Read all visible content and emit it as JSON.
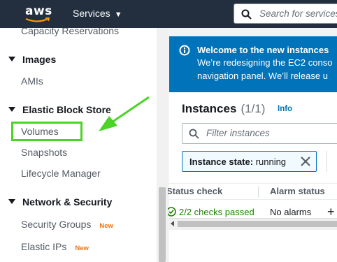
{
  "topbar": {
    "logo_text": "aws",
    "services_label": "Services",
    "search_placeholder": "Search for services"
  },
  "sidebar": {
    "items": [
      {
        "type": "link",
        "label": "Capacity Reservations"
      },
      {
        "type": "section",
        "label": "Images"
      },
      {
        "type": "link",
        "label": "AMIs"
      },
      {
        "type": "section",
        "label": "Elastic Block Store"
      },
      {
        "type": "link",
        "label": "Volumes",
        "highlighted": true
      },
      {
        "type": "link",
        "label": "Snapshots"
      },
      {
        "type": "link",
        "label": "Lifecycle Manager"
      },
      {
        "type": "section",
        "label": "Network & Security"
      },
      {
        "type": "link",
        "label": "Security Groups",
        "badge": "New"
      },
      {
        "type": "link",
        "label": "Elastic IPs",
        "badge": "New"
      }
    ]
  },
  "banner": {
    "title": "Welcome to the new instances",
    "line1": "We’re redesigning the EC2 conso",
    "line2": "navigation panel. We’ll release u"
  },
  "instances": {
    "title": "Instances",
    "count": "(1/1)",
    "info_label": "Info",
    "filter_placeholder": "Filter instances",
    "token_key": "Instance state:",
    "token_value": "running",
    "columns": [
      "Status check",
      "Alarm status"
    ],
    "row": {
      "status_check": "2/2 checks passed",
      "alarm_status": "No alarms"
    }
  },
  "colors": {
    "topbar": "#232f3e",
    "banner": "#0073bb",
    "highlight": "#4cd327",
    "badge": "#ec7211",
    "success": "#1d8102"
  }
}
